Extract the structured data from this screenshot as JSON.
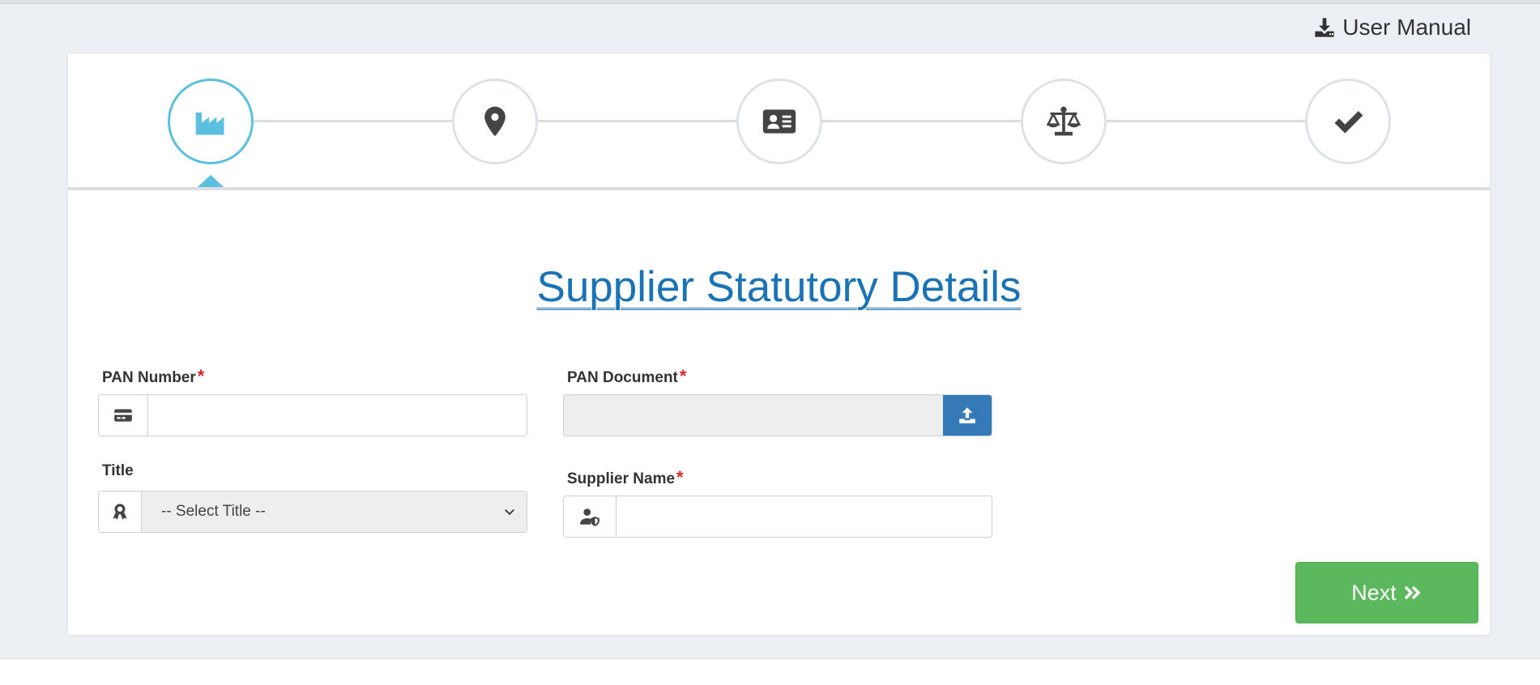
{
  "header": {
    "manual_label": "User Manual",
    "manual_icon": "download-icon"
  },
  "stepper": {
    "active_index": 0,
    "active_color": "#5bc0de",
    "steps": [
      {
        "icon": "factory-icon"
      },
      {
        "icon": "map-marker-icon"
      },
      {
        "icon": "address-card-icon"
      },
      {
        "icon": "balance-scale-icon"
      },
      {
        "icon": "check-icon"
      }
    ]
  },
  "form": {
    "title": "Supplier Statutory Details",
    "pan_number": {
      "label": "PAN Number",
      "required_mark": "*",
      "value": "",
      "icon": "credit-card-icon"
    },
    "pan_document": {
      "label": "PAN Document",
      "required_mark": "*",
      "value": "",
      "icon": "upload-icon"
    },
    "title_field": {
      "label": "Title",
      "selected": "-- Select Title --",
      "icon": "award-icon"
    },
    "supplier_name": {
      "label": "Supplier Name",
      "required_mark": "*",
      "value": "",
      "icon": "user-shield-icon"
    }
  },
  "actions": {
    "next_label": "Next",
    "next_icon": "double-chevron-right-icon"
  },
  "colors": {
    "primary": "#337ab7",
    "success": "#5cb85c",
    "title": "#1a73b5",
    "required": "#d9262a"
  }
}
